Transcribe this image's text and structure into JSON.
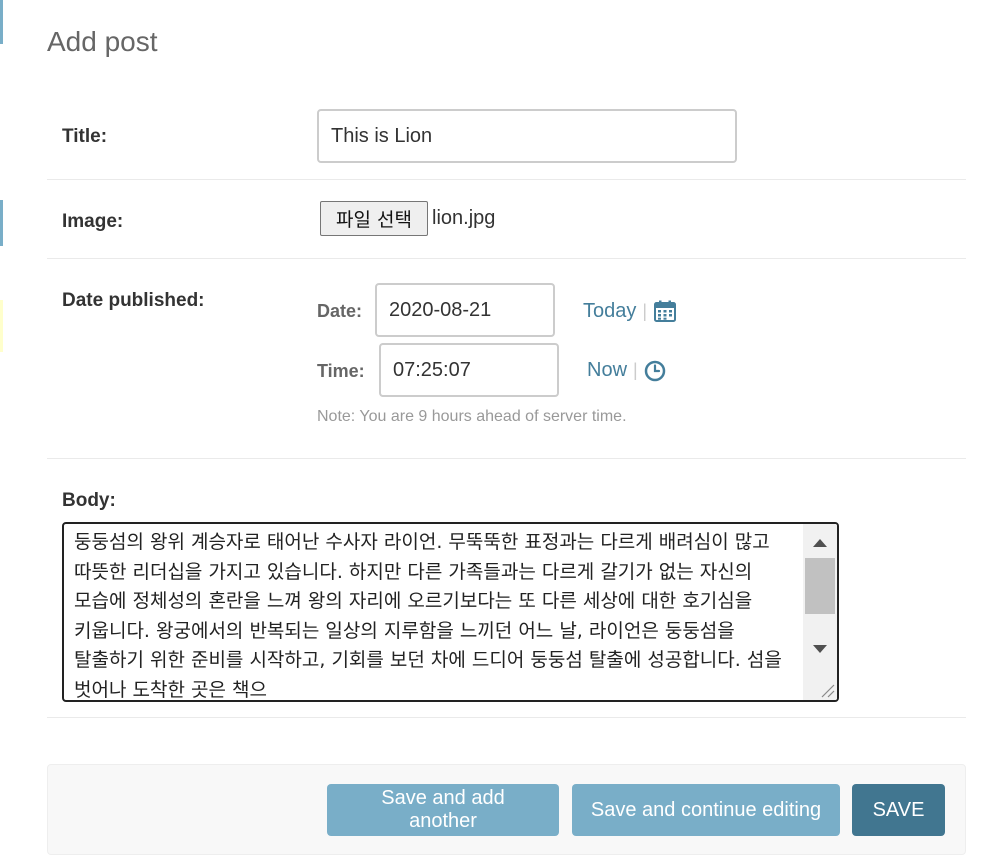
{
  "page": {
    "title": "Add post"
  },
  "form": {
    "title_field": {
      "label": "Title:",
      "value": "This is Lion"
    },
    "image_field": {
      "label": "Image:",
      "button_label": "파일 선택",
      "file_name": "lion.jpg"
    },
    "date_published_field": {
      "label": "Date published:",
      "date_label": "Date:",
      "date_value": "2020-08-21",
      "today_link": "Today",
      "separator": "|",
      "calendar_icon": "calendar-icon",
      "time_label": "Time:",
      "time_value": "07:25:07",
      "now_link": "Now",
      "clock_icon": "clock-icon",
      "help_note": "Note: You are 9 hours ahead of server time."
    },
    "body_field": {
      "label": "Body:",
      "value": "둥둥섬의 왕위 계승자로 태어난 수사자 라이언. 무뚝뚝한 표정과는 다르게 배려심이 많고 따뜻한 리더십을 가지고 있습니다. 하지만 다른 가족들과는 다르게 갈기가 없는 자신의 모습에 정체성의 혼란을 느껴 왕의 자리에 오르기보다는 또 다른 세상에 대한 호기심을 키웁니다. 왕궁에서의 반복되는 일상의 지루함을 느끼던 어느 날, 라이언은 둥둥섬을 탈출하기 위한 준비를 시작하고, 기회를 보던 차에 드디어 둥둥섬 탈출에 성공합니다. 섬을 벗어나 도착한 곳은 책으"
    }
  },
  "submit": {
    "save_add_another": "Save and add another",
    "save_continue": "Save and continue editing",
    "save": "SAVE"
  },
  "colors": {
    "link": "#447e9b",
    "button_light": "#79aec8",
    "button_dark": "#417690",
    "label": "#333333",
    "muted": "#999999"
  }
}
